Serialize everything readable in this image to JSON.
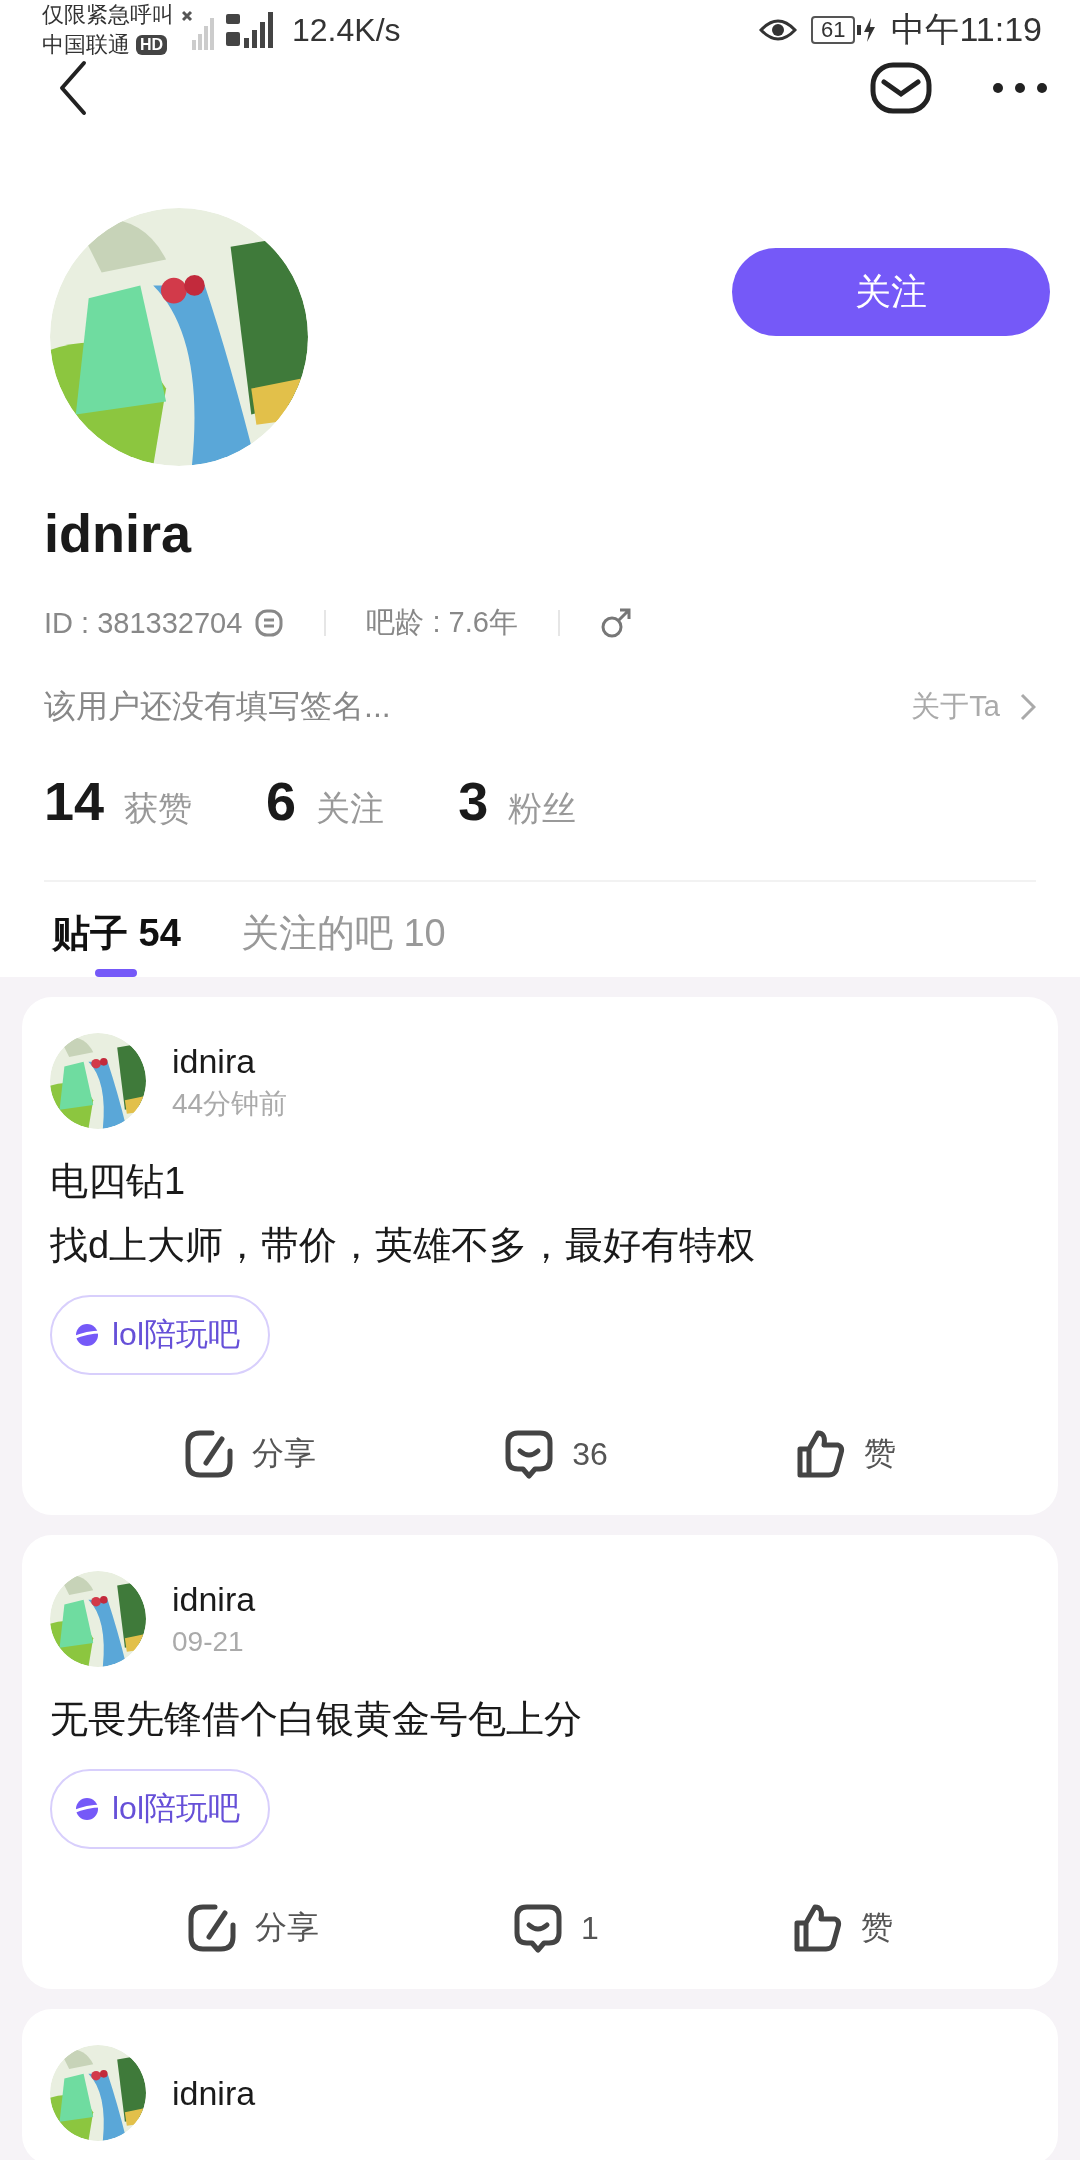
{
  "status_bar": {
    "notice": "仅限紧急呼叫",
    "carrier": "中国联通",
    "hd_badge": "HD",
    "net_speed": "12.4K/s",
    "battery": "61",
    "time": "中午11:19"
  },
  "profile": {
    "name": "idnira",
    "follow_button": "关注",
    "id": "ID : 381332704",
    "age": "吧龄 : 7.6年",
    "signature": "该用户还没有填写签名...",
    "about": "关于Ta",
    "stats": [
      {
        "value": "14",
        "label": "获赞"
      },
      {
        "value": "6",
        "label": "关注"
      },
      {
        "value": "3",
        "label": "粉丝"
      }
    ]
  },
  "tabs": [
    {
      "label": "贴子",
      "count": "54",
      "selected": true
    },
    {
      "label": "关注的吧",
      "count": "10",
      "selected": false
    }
  ],
  "posts": [
    {
      "author": "idnira",
      "time": "44分钟前",
      "text": "电四钻1\n找d上大师，带价，英雄不多，最好有特权",
      "forum": "lol陪玩吧",
      "share": "分享",
      "comments": "36",
      "like": "赞"
    },
    {
      "author": "idnira",
      "time": "09-21",
      "text": "无畏先锋借个白银黄金号包上分",
      "forum": "lol陪玩吧",
      "share": "分享",
      "comments": "1",
      "like": "赞"
    },
    {
      "author": "idnira"
    }
  ]
}
